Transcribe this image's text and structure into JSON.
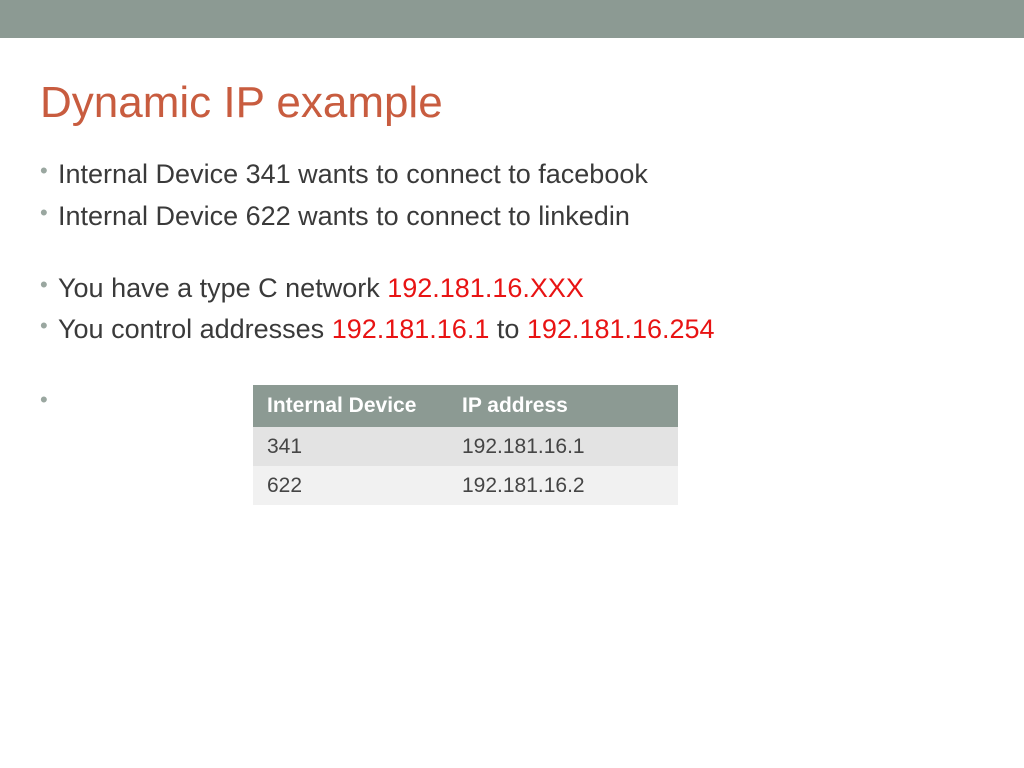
{
  "title": "Dynamic IP example",
  "bullets": {
    "b1": "Internal Device 341 wants to connect to facebook",
    "b2": "Internal Device 622 wants to connect to linkedin",
    "b3_pre": "You have a type C network ",
    "b3_red": "192.181.16.XXX",
    "b4_pre": "You control addresses ",
    "b4_red1": "192.181.16.1",
    "b4_mid": " to ",
    "b4_red2": "192.181.16.254"
  },
  "table": {
    "headers": {
      "device": "Internal Device",
      "ip": "IP address"
    },
    "rows": [
      {
        "device": "341",
        "ip": "192.181.16.1"
      },
      {
        "device": "622",
        "ip": "192.181.16.2"
      }
    ]
  }
}
